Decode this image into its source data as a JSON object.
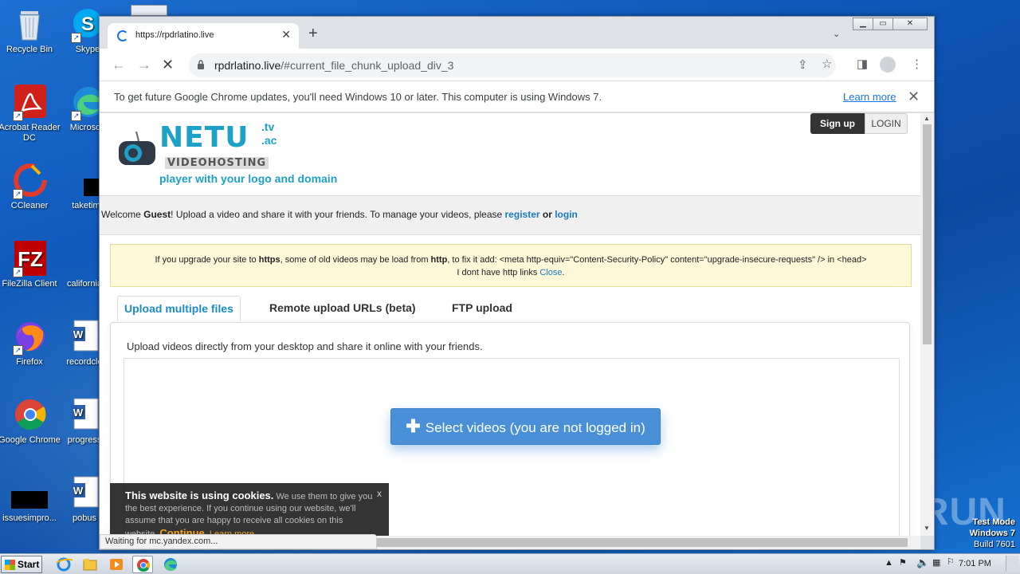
{
  "desktop": {
    "icons": [
      {
        "label": "Recycle Bin"
      },
      {
        "label": "Skype"
      },
      {
        "label": "Acrobat Reader DC"
      },
      {
        "label": "Microsoft"
      },
      {
        "label": "CCleaner"
      },
      {
        "label": "taketime"
      },
      {
        "label": "FileZilla Client"
      },
      {
        "label": "california"
      },
      {
        "label": "Firefox"
      },
      {
        "label": "recordclo"
      },
      {
        "label": "Google Chrome"
      },
      {
        "label": "progress"
      },
      {
        "label": "issuesimpro..."
      },
      {
        "label": "pobus"
      }
    ]
  },
  "browser": {
    "tab_title": "https://rpdrlatino.live",
    "url_host": "rpdrlatino.live",
    "url_path": "/#current_file_chunk_upload_div_3",
    "infobar_message": "To get future Google Chrome updates, you'll need Windows 10 or later. This computer is using Windows 7.",
    "infobar_link": "Learn more",
    "status_text": "Waiting for mc.yandex.com..."
  },
  "page": {
    "logo": {
      "name": "NETU",
      "tv": ".tv",
      "ac": ".ac",
      "sub": "VIDEOHOSTING",
      "tagline": "player with your logo and domain"
    },
    "signup": "Sign up",
    "login": "LOGIN",
    "welcome_prefix": "Welcome ",
    "welcome_user": "Guest",
    "welcome_middle": "! Upload a video and share it with your friends. To manage your videos, please ",
    "welcome_register": "register",
    "welcome_or": " or ",
    "welcome_login": "login",
    "notice_1a": "If you upgrade your site to ",
    "notice_https": "https",
    "notice_1b": ", some of old videos may be load from ",
    "notice_http": "http",
    "notice_1c": ", to fix it add: <meta http-equiv=\"Content-Security-Policy\" content=\"upgrade-insecure-requests\" /> in <head>",
    "notice_2": "I dont have http links ",
    "notice_close": "Close",
    "tabs": [
      {
        "label": "Upload multiple files"
      },
      {
        "label": "Remote upload URLs (beta)"
      },
      {
        "label": "FTP upload"
      }
    ],
    "upload_desc": "Upload videos directly from your desktop and share it online with your friends.",
    "select_button": "Select videos (you are not logged in)",
    "cookie": {
      "title": "This website is using cookies.",
      "body": " We use them to give you the best experience. If you continue using our website, we'll assume that you are happy to receive all cookies on this website. ",
      "continue": "Continue",
      "learn_more": "Learn more",
      "close": "x"
    }
  },
  "watermark": "ANY RUN",
  "testmode": {
    "line1": "Test Mode",
    "line2": "Windows 7",
    "line3": "Build 7601"
  },
  "taskbar": {
    "start": "Start",
    "clock": "7:01 PM"
  }
}
